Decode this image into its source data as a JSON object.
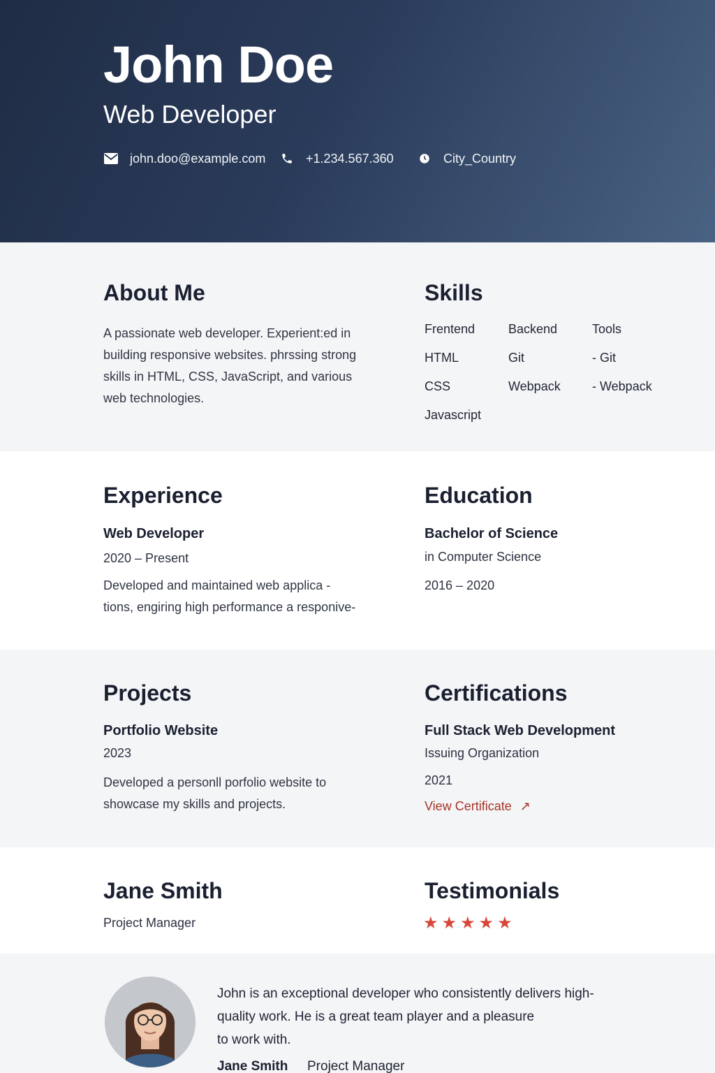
{
  "header": {
    "name": "John Doe",
    "title": "Web Developer",
    "contact": {
      "email": "john.doo@example.com",
      "phone": "+1.234.567.360",
      "location": "City_Country"
    },
    "icons": [
      "email-icon",
      "phone-icon",
      "location-icon"
    ]
  },
  "about": {
    "heading": "About Me",
    "lines": [
      "A passionate web developer. Experient:ed in",
      "building responsive websites. phrssing strong",
      "skills in HTML, CSS, JavaScript, and various",
      "web technologies."
    ]
  },
  "skills": {
    "heading": "Skills",
    "columns": [
      {
        "label": "Frentend",
        "items": [
          "HTML",
          "CSS",
          "Javascript"
        ]
      },
      {
        "label": "Backend",
        "items": [
          "Git",
          "Webpack",
          ""
        ]
      },
      {
        "label": "Tools",
        "items": [
          "- Git",
          "- Webpack",
          ""
        ]
      }
    ]
  },
  "experience": {
    "heading": "Experience",
    "role": "Web Developer",
    "period": "2020 – Present",
    "lines": [
      "Developed and maintained web applica -",
      "tions, engiring high performance a responive-"
    ]
  },
  "education": {
    "heading": "Education",
    "degree": "Bachelor of Science",
    "field": "in Computer Science",
    "period": "2016 – 2020"
  },
  "projects": {
    "heading": "Projects",
    "name": "Portfolio Website",
    "year": "2023",
    "lines": [
      "Developed a personll porfolio website to",
      "showcase my skills and projects."
    ]
  },
  "certifications": {
    "heading": "Certifications",
    "name": "Full Stack Web Development",
    "issuer": "Issuing Organization",
    "year": "2021",
    "link_label": "View Certificate",
    "link_color": "#a83226"
  },
  "reference": {
    "name": "Jane Smith",
    "role": "Project Manager"
  },
  "testimonials": {
    "heading": "Testimonials",
    "rating": 5,
    "rating_max": 5,
    "star_color": "#d8473a",
    "quote_lines": [
      "John is an exceptional developer who consistently delivers high-",
      "quality work. He is a great team player and a pleasure",
      "to work with."
    ],
    "author_name": "Jane Smith",
    "author_role": "Project Manager"
  }
}
